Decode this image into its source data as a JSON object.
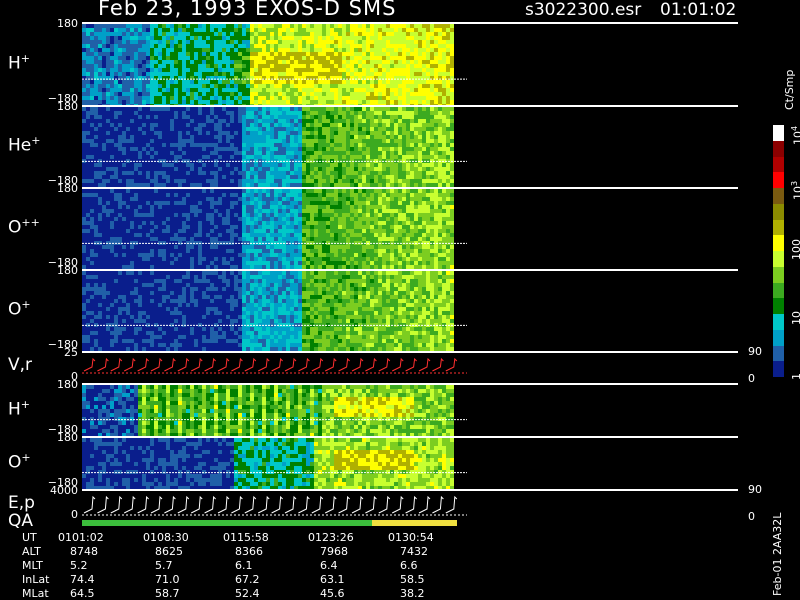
{
  "header": {
    "title": "Feb 23, 1993   EXOS-D SMS",
    "file": "s3022300.esr",
    "time": "01:01:02"
  },
  "colorbar": {
    "unit_label": "Ct/Smp",
    "ticks": [
      "10",
      "10",
      "100",
      "10",
      "1"
    ],
    "exponents": [
      "4",
      "3",
      "",
      "",
      ""
    ],
    "colors": [
      "#ffffff",
      "#8b0000",
      "#b00000",
      "#ff0000",
      "#7a5a10",
      "#8b8b00",
      "#b0b000",
      "#ffff00",
      "#c8ff30",
      "#7ccd20",
      "#3caa20",
      "#008000",
      "#00c8c8",
      "#00a0c8",
      "#2060a8",
      "#0a1e8c"
    ]
  },
  "panels": [
    {
      "id": "h-plus-1",
      "label": "H",
      "sup": "+",
      "ymax": "180",
      "ymin": "−180"
    },
    {
      "id": "he-plus",
      "label": "He",
      "sup": "+",
      "ymax": "180",
      "ymin": "−180"
    },
    {
      "id": "o-plus-plus",
      "label": "O",
      "sup": "++",
      "ymax": "180",
      "ymin": "−180"
    },
    {
      "id": "o-plus-1",
      "label": "O",
      "sup": "+",
      "ymax": "180",
      "ymin": "−180"
    },
    {
      "id": "v-r",
      "label": "V,r",
      "sup": "",
      "ymax": "25",
      "ymin": "0",
      "rmax": "90",
      "rmin": "0"
    },
    {
      "id": "h-plus-2",
      "label": "H",
      "sup": "+",
      "ymax": "180",
      "ymin": "−180"
    },
    {
      "id": "o-plus-2",
      "label": "O",
      "sup": "+",
      "ymax": "180",
      "ymin": "−180"
    },
    {
      "id": "e-p",
      "label": "E,p",
      "sup": "",
      "ymax": "4000",
      "ymin": "0",
      "rmax": "90",
      "rmin": "0"
    }
  ],
  "qa_label": "QA",
  "footer": {
    "rows": [
      {
        "label": "UT",
        "values": [
          "0101:02",
          "0108:30",
          "0115:58",
          "0123:26",
          "0130:54"
        ]
      },
      {
        "label": "ALT",
        "values": [
          "8748",
          "8625",
          "8366",
          "7968",
          "7432"
        ]
      },
      {
        "label": "MLT",
        "values": [
          "5.2",
          "5.7",
          "6.1",
          "6.4",
          "6.6"
        ]
      },
      {
        "label": "InLat",
        "values": [
          "74.4",
          "71.0",
          "67.2",
          "63.1",
          "58.5"
        ]
      },
      {
        "label": "MLat",
        "values": [
          "64.5",
          "58.7",
          "52.4",
          "45.6",
          "38.2"
        ]
      }
    ],
    "stamp": "Feb-01 2AA32L"
  },
  "chart_data": {
    "type": "heatmap",
    "title": "Feb 23, 1993   EXOS-D SMS",
    "x": [
      "0101:02",
      "0108:30",
      "0115:58",
      "0123:26",
      "0130:54"
    ],
    "colorbar_range": [
      1,
      10000
    ],
    "colorbar_scale": "log",
    "colorbar_unit": "Ct/Smp"
  }
}
